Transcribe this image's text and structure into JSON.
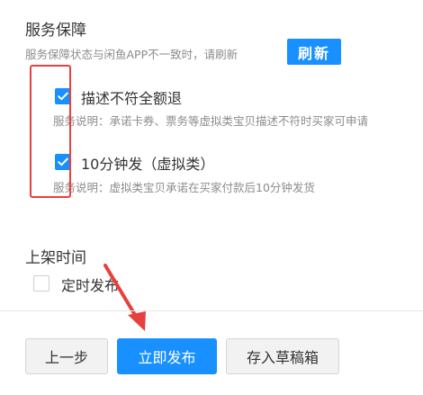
{
  "service": {
    "title": "服务保障",
    "notice": "服务保障状态与闲鱼APP不一致时，请刷新",
    "refresh_label": "刷新",
    "options": [
      {
        "label": "描述不符全额退",
        "checked": true,
        "description": "服务说明：承诺卡券、票务等虚拟类宝贝描述不符时买家可申请"
      },
      {
        "label": "10分钟发（虚拟类）",
        "checked": true,
        "description": "服务说明：虚拟类宝贝承诺在买家付款后10分钟发货"
      }
    ]
  },
  "listing": {
    "title": "上架时间",
    "scheduled_label": "定时发布",
    "scheduled_checked": false
  },
  "footer": {
    "prev_label": "上一步",
    "publish_label": "立即发布",
    "draft_label": "存入草稿箱"
  },
  "colors": {
    "accent": "#1890ff",
    "annotation": "#e8403d"
  }
}
